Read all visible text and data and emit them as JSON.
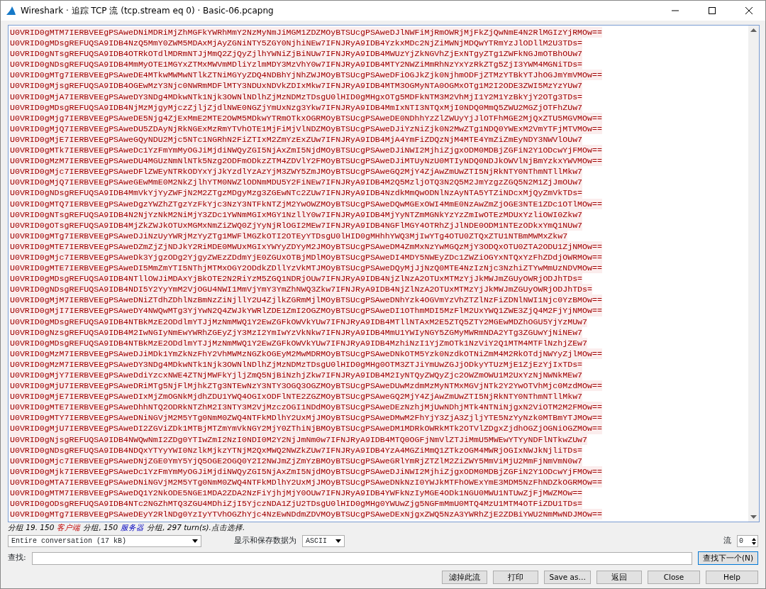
{
  "window": {
    "title": "Wireshark · 追踪 TCP 流 (tcp.stream eq 0) · Basic-06.pcapng"
  },
  "stream_lines": [
    "U0VRID0gMTM7IERBVEEgPSAweDNiMDRiMjZhMGFkYWRhMmY2NzMyNmJiMGM1ZDZMOyBTSUcgPSAweDJlNWFiMjRmOWRjMjFkZjQwNmE4N2RlMGIzYjRMOw==",
    "U0VRID0gMDsgREFUQSA9IDB4NzQ5MmY0ZWM5MDAxMjAyZGNiNTY5ZGY0NjhiNEw7IFNJRyA9IDB4YzkxMDc2NjZiMWNjMDQwYTRmYzJlODllM2U3TDs=",
    "U0VRID0gNTsgREFUQSA9IDB4OTRkOTdlMDRmNTJjMmQ2ZjQyZjlhYWNiZjBiNUw7IFNJRyA9IDB4MWUzYjZkNGVhZjExNTgyZTg1ZWFkNGJmOTBhOUw7",
    "U0VRID0gNDsgREFUQSA9IDB4MmMyOTE1MGYxZTMxMWVmMDliYzlmMDY3MzVhY0w7IFNJRyA9IDB4MTY2NWZiMmRhNzYxYzRkZTg5ZjI3YWM4MGNiTDs=",
    "U0VRID0gMTg7IERBVEEgPSAweDE4MTkwMWMwNTlkZTNiMGYyZDQ4NDBhYjNhZWJMOyBTSUcgPSAweDFiOGJkZjk0NjhmODFjZTMzYTBkYTJhOGJmYmVMOw==",
    "U0VRID0gMjsgREFUQSA9IDB4OGEwMzY3Njc0NWRmMDFlMTY3NDUxNDVkZDIxMkw7IFNJRyA9IDB4MTM3OGMyNTA0OGMxOTg1M2I2ODE3ZWI5MzYzYUw7",
    "U0VRID0gMjA7IERBVEEgPSAweDY3NDg4MDkwNTk1Njk3OWNlNDlhZjMzNDMzTDsgU0lHID0gMHgxOTg5MDFkNTM3M2VhMjI1Y2M1YzBkYjY2OTg3TDs=",
    "U0VRID0gMDsgREFUQSA9IDB4NjMzMjgyMjczZjljZjdlNWE0NGZjYmUxNzg3Ykw7IFNJRyA9IDB4MmIxNTI3NTQxMjI0NDQ0MmQ5ZWU2MGZjOTFhZUw7",
    "U0VRID0gMjg7IERBVEEgPSAweDE5Njg4ZjExMmE2MTE2OWM5MDkwYTRmOTkxOGRMOyBTSUcgPSAweDE0NDhhYzZlZWUyYjJlOTFhMGE2MjQxZTU5MGVMOw==",
    "U0VRID0gMjQ7IERBVEEgPSAweDU5ZDAyNjRkNGExMzRmYTVhOTE1MjFiMjVlNDZMOyBTSUcgPSAweDJiYzNiZjk0N2MwZTg1NDQ0YWExM2VmYTFjMTVMOw==",
    "U0VRID0gMjE7IERBVEEgPSAweGQyNDU2Mjc5NTc1NGRhN2FiZTIxM2ZmYzExZUw7IFNJRyA9IDB4MjA4YmFiZDQzNjM4MTE4YmZiZmEyNDY3NWVlOUw7",
    "U0VRID0gMTk7IERBVEEgPSAweDc1YzFmYmMyOGJiMjdiNWQyZGI5NjAxZmI5NjdMOyBTSUcgPSAweDJiNWI2MjhiZjgxODM0MDBjZGFiN2Y1ODcwYjFMOw==",
    "U0VRID0gMzM7IERBVEEgPSAweDU4MGUzNmNlNTk5Nzg2ODFmODkzZTM4ZDVlY2FMOyBTSUcgPSAweDJiMTUyNzU0MTIyNDQ0NDJkOWVlNjBmYzkxYWVMOw==",
    "U0VRID0gMjc7IERBVEEgPSAweDFlZWEyNTRkODYxYjJkYzdlYzAzYjM3ZWY5ZmJMOyBTSUcgPSAweGQ2MjY4ZjAwZmUwZTI5NjRkNTY0NThmNTllMkw7",
    "U0VRID0gMjQ7IERBVEEgPSAweGEwMmE0M2NkZjlhYTM0NWZlODNmMDU5Y2FiNEw7IFNJRyA9IDB4M2Q5MzljOTQ3N2Q5M2JmYzgzZGQ5N2M1ZjJmOUw7",
    "U0VRID0gNDsgREFUQSA9IDB4MmVkYjYyZWFjN2M2ZTgzMDgyMzg3ZGEwNTc2ZUw7IFNJRyA9IDB4NzdkMmQwODNlNzAyNTA5YTZiNDcxMjQyZmVkTDs=",
    "U0VRID0gMTQ7IERBVEEgPSAweDgzYWZhZTgzYzFkYjc3NzY3NTFkNTZjM2YwOWZMOyBTSUcgPSAweDQwMGExOWI4MmE0NzAwZmZjOGE3NTE1ZDc1OTlMOw==",
    "U0VRID0gNTsgREFUQSA9IDB4N2NjYzNkM2NiMjY3ZDc1YWNmMGIxMGY1NzllY0w7IFNJRyA9IDB4MjYyNTZmMGNkYzYzZmIwOTEzMDUxYzliOWI0Zkw7",
    "U0VRID0gOTsgREFUQSA9IDB4MjZkZWJkOTUxMGMxNmZiZWQ0ZjYyNjRlOGI2MEw7IFNJRyA9IDB4NGFlMGY4OTRhZjJlNDE0ODM1NTEzODkxYmQ1NUw7",
    "U0VRID0gMTg7IERBVEEgPSAweDJiNzUyYWRjMzYyZTg1MWFlMGZkOTI2OTEyYTDsgU0lHID0gMHhhYWQ3MjIwYTg4OTU0ZTQxZTU1NTBmMWMxZkw7",
    "U0VRID0gMTE7IERBVEEgPSAweDZmZjZjNDJkY2RiMDE0MWUxMGIxYWYyZDYyM2JMOyBTSUcgPSAweDM4ZmMxNzYwMGQzMjY3ODQxOTU0ZTA2ODU1ZjNMOw==",
    "U0VRID0gMjc7IERBVEEgPSAweDk3YjgzODg2YjgyZWEzZDdmYjE0ZGUxOTBjMDlMOyBTSUcgPSAweDI4MDY5NWEyZDc1ZWZiOGYxNTQxYzFhZDdjOWRMOw==",
    "U0VRID0gMTE7IERBVEEgPSAweDI5MmZmYTI5NThjMTMxOGY2ODdkZDllYzVkMTJMOyBTSUcgPSAweDQyMjJjNzQ0MTE4NzIzNjc3NzhiZTYwMmUzNDVMOw==",
    "U0VRID0gMDsgREFUQSA9IDB4NTllOWJiMDAxYjBkOTE2N2RiYzM5ZGQ1NDRjOUw7IFNJRyA9IDB4NjZlNzA2OTUxMTMzYjJkMWJmZGUyOWRjODJhTDs=",
    "U0VRID0gNDsgREFUQSA9IDB4NDI5Y2YyYmM2VjOGU4NWI1MmVjYmY3YmZhNWQ3Zkw7IFNJRyA9IDB4NjZlNzA2OTUxMTMzYjJkMWJmZGUyOWRjODJhTDs=",
    "U0VRID0gMjM7IERBVEEgPSAweDNiZTdhZDhlNzBmNzZiNjllY2U4ZjlkZGRmMjlMOyBTSUcgPSAweDNhYzk4OGVmYzVhZTZlNzFiZDNlNWI1Njc0YzBMOw==",
    "U0VRID0gMjI7IERBVEEgPSAweDY4NWQwMTg3YjYwN2Q4ZWJkYWRlZDE1ZmI2OGZMOyBTSUcgPSAweDI1OThmMDI5MzFlM2UxYWQ1ZWE3ZjQ4M2FjYjNMOw==",
    "U0VRID0gMDsgREFUQSA9IDB4NTBkMzE2ODdlmYTJjMzNmMWQ1Y2EwZGFkOWVkYUw7IFNJRyA9IDB4MTllNTAxM2E5ZTQ5ZTY2MGEwMDZhOGU5YjYzMUw7",
    "U0VRID0gNzsgREFUQSA9IDB4M2IwNGIyNmEwYWRhZGEyZjY3MzI2YmIwYzVkNkw7IFNJRyA9IDB4MmU1YWIyNGY5ZGMyMWRmNDA2YTg3ZGUwYjNiNEw7",
    "U0VRID0gMDsgREFUQSA9IDB4NTBkMzE2ODdlmYTJjMzNmMWQ1Y2EwZGFkOWVkYUw7IFNJRyA9IDB4MzhiNzI1YjZmOTk1NzViY2Q1MTM4MTFlNzhjZEw7",
    "U0VRID0gMzM7IERBVEEgPSAweDJiMDk1YmZkNzFhY2VhMWMzNGZkOGEyM2MwMDRMOyBTSUcgPSAweDNkOTM5Yzk0NzdkOTNiZmM4M2RkOTdjNWYyZjlMOw==",
    "U0VRID0gMzM7IERBVEEgPSAweDY3NDg4MDkwNTk1Njk3OWNlNDlhZjMzNDMzTDsgU0lHID0gMHg0OTM3ZTJiYmUwZGJjODkyYTUzMjE1ZjEzYjIxTDs=",
    "U0VRID0gMjY7IERBVEEgPSAweDdiYzcxNWE4ZTNjMWFkYjljZmQ5NjBiNzhjZkw7IFNJRyA9IDB4M2IyNTQyZWQyZjc2OWZmOWU1M2UxYzNjNWNkMEw7",
    "U0VRID0gMjU7IERBVEEgPSAweDRiMTg5NjFlMjhkZTg3NTEwNzY3NTY3OGQ3OGZMOyBTSUcgPSAweDUwMzdmMzMyNTMxMGVjNTk2Y2YwOTVhMjc0MzdMOw==",
    "U0VRID0gMjE7IERBVEEgPSAweDIxMjZmOGNkMjdhZDU1YWQ4OGIxODFlNTE2ZGZMOyBTSUcgPSAweGQ2MjY4ZjAwZmUwZTI5NjRkNTY0NThmNTllMkw7",
    "U0VRID0gMTE7IERBVEEgPSAweDhhNTQ2ODRkNTZhM2I3NTY3M2VjMzczOGI1NDdMOyBTSUcgPSAweDEzNzhjMjUwNDhjMTk4NTNiNjgxN2ViOTM2M2FMOw==",
    "U0VRID0gMTY7IERBVEEgPSAweDNiNGVjM2M5YTg0NmM0ZWQ4NTFkMDlhY2UxMjJMOyBTSUcgPSAweDMwM2FhYjY3ZjA3ZjljYTE5NzYyNzk0MTBmYTJMOw==",
    "U0VRID0gMjU7IERBVEEgPSAweDI2ZGViZDk1MTBjMTZmYmVkNGY2MjY0ZThiNjBMOyBTSUcgPSAweDM1MDRkOWRkMTk2OTVlZDgxZjdhOGZjOGNiOGZMOw==",
    "U0VRID0gNjsgREFUQSA9IDB4NWQwNmI2ZDg0YTIwZmI2NzI0NDI0M2Y2NjJmNm0w7IFNJRyA9IDB4MTQ0OGFjNmVlZTJiMmU5MWEwYTYyNDFlNTkwZUw7",
    "U0VRID0gNDsgREFUQSA9IDB4NDQxYTYyYWI0NzlkMjkzYTNjM2QxMWQ2NWZkZUw7IFNJRyA9IDB4YzA4MGZiMmQ1ZTkzOGM4MWRjOGIxNWJkNjliTDs=",
    "U0VRID0gMjc7IERBVEEgPSAweDNjZGE0YmY5YjQ5OGE2OGQ0Y2I2NWJmZjZmYzBMOyBTSUcgPSAweGRlYmRjZTZlM2ZiZWY5MmViMjU2MmFjNmVmN0w7",
    "U0VRID0gMjk7IERBVEEgPSAweDc1YzFmYmMyOGJiMjdiNWQyZGI5NjAxZmI5NjdMOyBTSUcgPSAweDJiNWI2MjhiZjgxODM0MDBjZGFiN2Y1ODcwYjFMOw==",
    "U0VRID0gMTA7IERBVEEgPSAweDNiNGVjM2M5YTg0NmM0ZWQ4NTFkMDlhY2UxMjJMOyBTSUcgPSAweDNkNzI0YWJkMTFhOWExYmE3MDM5NzFhNDZkOGRMOw==",
    "U0VRID0gMTM7IERBVEEgPSAweDQ1Y2NkODE5NGE1MDA2ZDA2NzFiYjhjMjY0OUw7IFNJRyA9IDB4YWFkNzIyMGE4ODk1NGU0MWU1NTUwZjFjMWZMOw==",
    "U0VRID0gODsgREFUQSA9IDB4NTc2NGZhMTQ3ZGU4MDhiZjI5YjczNDA1ZjU2TDsgU0lHID0gMHg0YWUwZjg5NGFmMmU0MTQ4MzU1MTM4OTFiZDU1TDs=",
    "U0VRID0gMTg7IERBVEEgPSAweDEyY2RlNDg0YzIyYTVhOGZhYjc4NzEwNDdmZDVMOyBTSUcgPSAweDExNjgxZWQ5NzA3YWRhZjE2ZDBiYWU2NmMwNDJMOw=="
  ],
  "status_bar": [
    {
      "kind": "plain",
      "text": "分组 19. 150"
    },
    {
      "kind": "client",
      "text": "客户端"
    },
    {
      "kind": "plain",
      "text": "分组, 150"
    },
    {
      "kind": "server",
      "text": "服务器"
    },
    {
      "kind": "plain",
      "text": "分组, 297 turn(s).点击选择."
    }
  ],
  "conversation_select": {
    "value": "Entire conversation (17 kB)"
  },
  "format": {
    "label": "显示和保存数据为",
    "value": "ASCII"
  },
  "stream": {
    "label": "流",
    "value": "0"
  },
  "find": {
    "label": "查找:",
    "button": "查找下一个(N)"
  },
  "buttons": [
    "滤掉此流",
    "打印",
    "Save as…",
    "返回",
    "Close",
    "Help"
  ]
}
